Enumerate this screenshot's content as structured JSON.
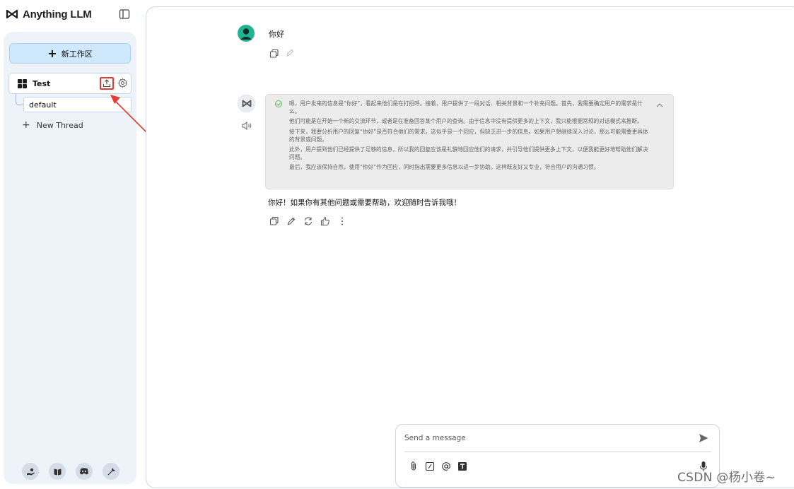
{
  "app": {
    "name": "Anything LLM"
  },
  "sidebar": {
    "new_workspace_label": "新工作区",
    "workspace": {
      "name": "Test",
      "threads": [
        {
          "label": "default"
        }
      ],
      "new_thread_label": "New Thread"
    }
  },
  "chat": {
    "user_message": "你好",
    "thought_paragraphs": [
      "嗯，用户发来的信息是“你好”，看起来他们是在打招呼。接着，用户提供了一段对话、相关背景和一个补充问题。首先，我需要确定用户的需求是什么。",
      "他们可能是在开始一个新的交流环节，或者是在准备回答某个用户的查询。由于信息中没有提供更多的上下文，我只能根据常规的对话模式来推断。",
      "接下来，我要分析用户的回复“你好”是否符合他们的需求。这似乎是一个回应，但缺乏进一步的信息。如果用户想继续深入讨论，那么可能需要更具体的背景或问题。",
      "此外，用户提到他们已经提供了足够的信息，所以我的回复应该是礼貌地回应他们的请求，并引导他们提供更多上下文，以便我能更好地帮助他们解决问题。",
      "最后，我应该保持自然，使用“你好”作为回应，同时指出需要更多信息以进一步协助。这样既友好又专业，符合用户的沟通习惯。"
    ],
    "bot_reply": "你好！如果你有其他问题或需要帮助，欢迎随时告诉我哦！"
  },
  "composer": {
    "placeholder": "Send a message"
  },
  "watermark": "CSDN @杨小卷~",
  "colors": {
    "accent_blue": "#cfe8fb",
    "user_avatar": "#1fb592",
    "annotation_red": "#e23b36"
  }
}
